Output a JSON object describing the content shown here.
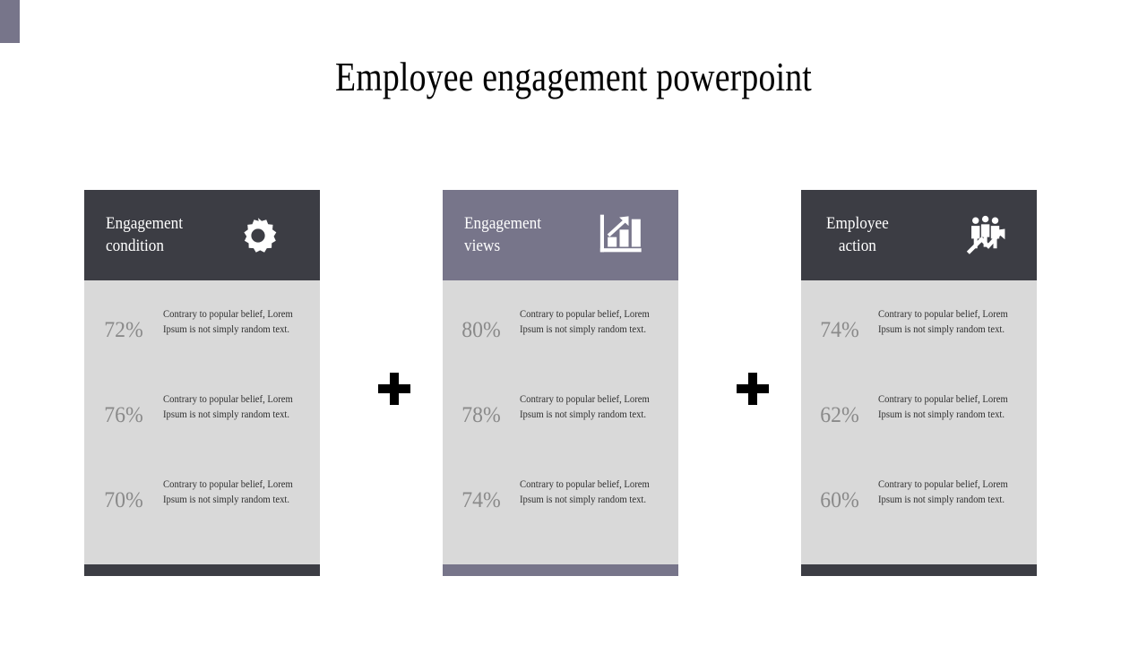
{
  "slide": {
    "title": "Employee engagement powerpoint",
    "background_color": "#ffffff",
    "corner_mark_color": "#77758a",
    "dark_color": "#3c3d44",
    "accent_color": "#77758a",
    "body_color": "#d9d9d9",
    "percent_text_color": "#8a8a8a"
  },
  "separators": [
    {
      "symbol": "+",
      "name": "plus-separator-1"
    },
    {
      "symbol": "+",
      "name": "plus-separator-2"
    }
  ],
  "cards": [
    {
      "title": "Engagement\ncondition",
      "icon": "gear-icon",
      "header_color": "#3c3d44",
      "footer_color": "#3c3d44",
      "rows": [
        {
          "percent": "72%",
          "text": "Contrary to popular belief, Lorem Ipsum is not simply random text."
        },
        {
          "percent": "76%",
          "text": "Contrary to popular belief, Lorem Ipsum is not simply random text."
        },
        {
          "percent": "70%",
          "text": "Contrary to popular belief, Lorem Ipsum is not simply random text."
        }
      ]
    },
    {
      "title": "Engagement\nviews",
      "icon": "bar-chart-growth-icon",
      "header_color": "#77758a",
      "footer_color": "#77758a",
      "rows": [
        {
          "percent": "80%",
          "text": "Contrary to popular belief, Lorem Ipsum is not simply random text."
        },
        {
          "percent": "78%",
          "text": "Contrary to popular belief, Lorem Ipsum is not simply random text."
        },
        {
          "percent": "74%",
          "text": "Contrary to popular belief, Lorem Ipsum is not simply random text."
        }
      ]
    },
    {
      "title": "Employee\naction",
      "icon": "people-growth-icon",
      "header_color": "#3c3d44",
      "footer_color": "#3c3d44",
      "rows": [
        {
          "percent": "74%",
          "text": "Contrary to popular belief, Lorem Ipsum is not simply random text."
        },
        {
          "percent": "62%",
          "text": "Contrary to popular belief, Lorem Ipsum is not simply random text."
        },
        {
          "percent": "60%",
          "text": "Contrary to popular belief, Lorem Ipsum is not simply random text."
        }
      ]
    }
  ]
}
